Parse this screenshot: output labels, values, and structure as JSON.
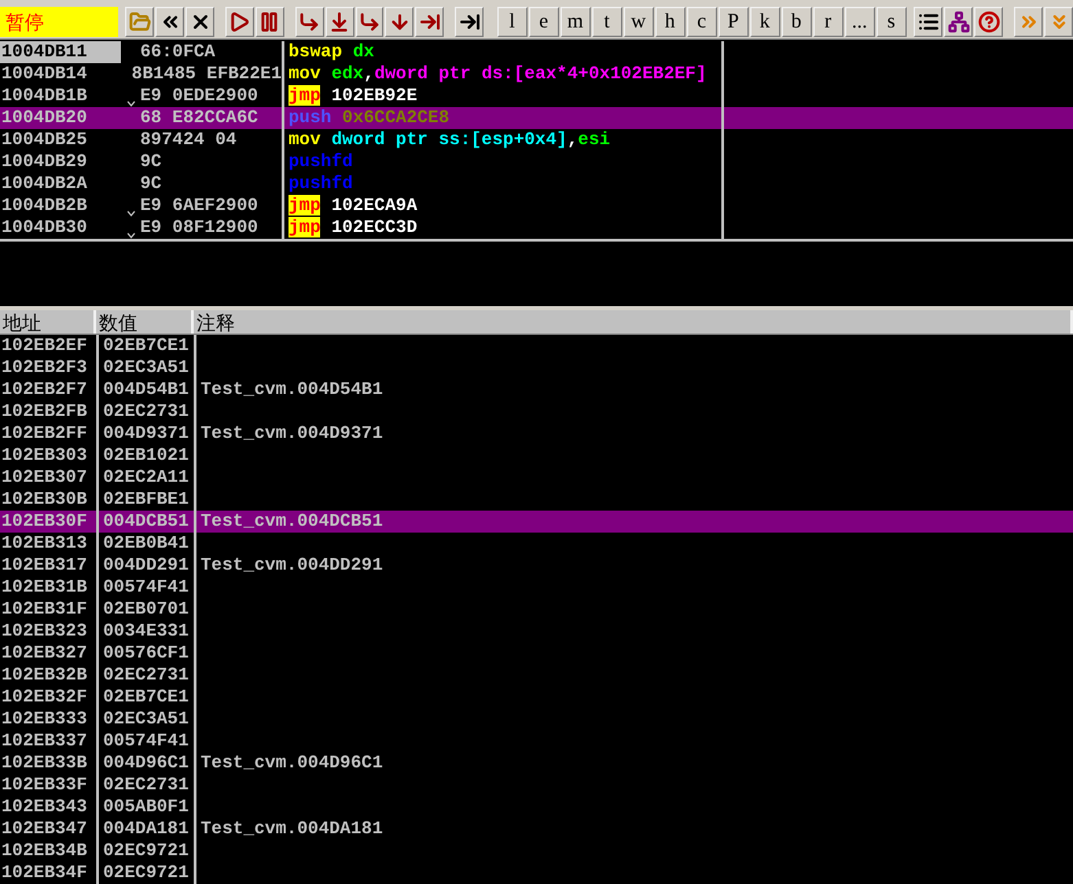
{
  "status": "暂停",
  "toolbar_letters": [
    "l",
    "e",
    "m",
    "t",
    "w",
    "h",
    "c",
    "P",
    "k",
    "b",
    "r",
    "...",
    "s"
  ],
  "disasm": [
    {
      "address": "1004DB11",
      "hex": "66:0FCA",
      "jump_mark": false,
      "selected": false,
      "current": true,
      "tokens": [
        {
          "text": "bswap",
          "kind": "plain",
          "color": "#ffff00"
        },
        {
          "text": " dx",
          "kind": "plain",
          "color": "#00ff00"
        }
      ]
    },
    {
      "address": "1004DB14",
      "hex": "8B1485 EFB22E1",
      "jump_mark": false,
      "selected": false,
      "current": false,
      "tokens": [
        {
          "text": "mov",
          "kind": "plain",
          "color": "#ffff00"
        },
        {
          "text": " edx",
          "kind": "plain",
          "color": "#00ff00"
        },
        {
          "text": ",",
          "kind": "plain",
          "color": "#ffffff"
        },
        {
          "text": "dword ptr ds:[eax*4+0x102EB2EF]",
          "kind": "plain",
          "color": "#ff00ff"
        }
      ]
    },
    {
      "address": "1004DB1B",
      "hex": "E9 0EDE2900",
      "jump_mark": true,
      "selected": false,
      "current": false,
      "tokens": [
        {
          "text": "jmp",
          "kind": "jump"
        },
        {
          "text": " 102EB92E",
          "kind": "plain",
          "color": "#ffffff"
        }
      ]
    },
    {
      "address": "1004DB20",
      "hex": "68 E82CCA6C",
      "jump_mark": false,
      "selected": true,
      "current": false,
      "tokens": [
        {
          "text": "push",
          "kind": "plain",
          "color": "#5050ff"
        },
        {
          "text": " 0x6CCA2CE8",
          "kind": "plain",
          "color": "#808000"
        }
      ]
    },
    {
      "address": "1004DB25",
      "hex": "897424 04",
      "jump_mark": false,
      "selected": false,
      "current": false,
      "tokens": [
        {
          "text": "mov",
          "kind": "plain",
          "color": "#ffff00"
        },
        {
          "text": " dword ptr ss:[esp+0x4]",
          "kind": "plain",
          "color": "#00ffff"
        },
        {
          "text": ",",
          "kind": "plain",
          "color": "#ffffff"
        },
        {
          "text": "esi",
          "kind": "plain",
          "color": "#00ff00"
        }
      ]
    },
    {
      "address": "1004DB29",
      "hex": "9C",
      "jump_mark": false,
      "selected": false,
      "current": false,
      "tokens": [
        {
          "text": "pushfd",
          "kind": "plain",
          "color": "#0000ff"
        }
      ]
    },
    {
      "address": "1004DB2A",
      "hex": "9C",
      "jump_mark": false,
      "selected": false,
      "current": false,
      "tokens": [
        {
          "text": "pushfd",
          "kind": "plain",
          "color": "#0000ff"
        }
      ]
    },
    {
      "address": "1004DB2B",
      "hex": "E9 6AEF2900",
      "jump_mark": true,
      "selected": false,
      "current": false,
      "tokens": [
        {
          "text": "jmp",
          "kind": "jump"
        },
        {
          "text": " 102ECA9A",
          "kind": "plain",
          "color": "#ffffff"
        }
      ]
    },
    {
      "address": "1004DB30",
      "hex": "E9 08F12900",
      "jump_mark": true,
      "selected": false,
      "current": false,
      "tokens": [
        {
          "text": "jmp",
          "kind": "jump"
        },
        {
          "text": " 102ECC3D",
          "kind": "plain",
          "color": "#ffffff"
        }
      ]
    }
  ],
  "stack": {
    "columns": [
      "地址",
      "数值",
      "注释"
    ],
    "rows": [
      {
        "address": "102EB2EF",
        "value": "02EB7CE1",
        "selected": false
      },
      {
        "address": "102EB2F3",
        "value": "02EC3A51",
        "selected": false
      },
      {
        "address": "102EB2F7",
        "value": "004D54B1",
        "comment": "Test_cvm.004D54B1",
        "selected": false
      },
      {
        "address": "102EB2FB",
        "value": "02EC2731",
        "selected": false
      },
      {
        "address": "102EB2FF",
        "value": "004D9371",
        "comment": "Test_cvm.004D9371",
        "selected": false
      },
      {
        "address": "102EB303",
        "value": "02EB1021",
        "selected": false
      },
      {
        "address": "102EB307",
        "value": "02EC2A11",
        "selected": false
      },
      {
        "address": "102EB30B",
        "value": "02EBFBE1",
        "selected": false
      },
      {
        "address": "102EB30F",
        "value": "004DCB51",
        "comment": "Test_cvm.004DCB51",
        "selected": true
      },
      {
        "address": "102EB313",
        "value": "02EB0B41",
        "selected": false
      },
      {
        "address": "102EB317",
        "value": "004DD291",
        "comment": "Test_cvm.004DD291",
        "selected": false
      },
      {
        "address": "102EB31B",
        "value": "00574F41",
        "selected": false
      },
      {
        "address": "102EB31F",
        "value": "02EB0701",
        "selected": false
      },
      {
        "address": "102EB323",
        "value": "0034E331",
        "selected": false
      },
      {
        "address": "102EB327",
        "value": "00576CF1",
        "selected": false
      },
      {
        "address": "102EB32B",
        "value": "02EC2731",
        "selected": false
      },
      {
        "address": "102EB32F",
        "value": "02EB7CE1",
        "selected": false
      },
      {
        "address": "102EB333",
        "value": "02EC3A51",
        "selected": false
      },
      {
        "address": "102EB337",
        "value": "00574F41",
        "selected": false
      },
      {
        "address": "102EB33B",
        "value": "004D96C1",
        "comment": "Test_cvm.004D96C1",
        "selected": false
      },
      {
        "address": "102EB33F",
        "value": "02EC2731",
        "selected": false
      },
      {
        "address": "102EB343",
        "value": "005AB0F1",
        "selected": false
      },
      {
        "address": "102EB347",
        "value": "004DA181",
        "comment": "Test_cvm.004DA181",
        "selected": false
      },
      {
        "address": "102EB34B",
        "value": "02EC9721",
        "selected": false
      },
      {
        "address": "102EB34F",
        "value": "02EC9721",
        "selected": false
      }
    ]
  }
}
